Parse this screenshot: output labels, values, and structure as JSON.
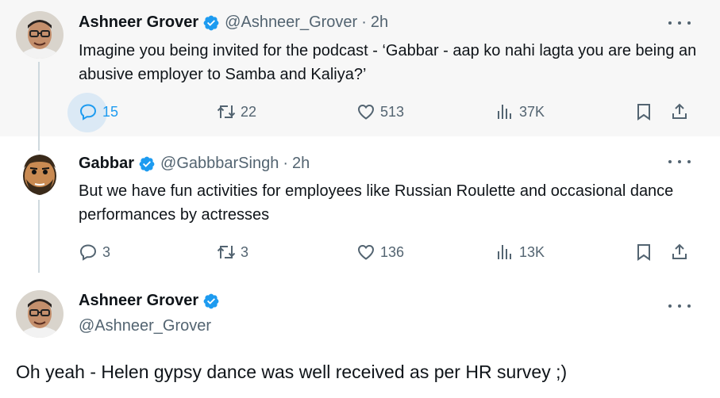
{
  "tweets": [
    {
      "name": "Ashneer Grover",
      "handle": "@Ashneer_Grover",
      "dot": "·",
      "time": "2h",
      "text": "Imagine you being invited for the podcast - ‘Gabbar - aap ko nahi lagta you are being an abusive employer to Samba and Kaliya?’",
      "replies": "15",
      "retweets": "22",
      "likes": "513",
      "views": "37K"
    },
    {
      "name": "Gabbar",
      "handle": "@GabbbarSingh",
      "dot": "·",
      "time": "2h",
      "text": "But we have fun activities for employees like Russian Roulette and occasional dance performances by actresses",
      "replies": "3",
      "retweets": "3",
      "likes": "136",
      "views": "13K"
    }
  ],
  "focus_tweet": {
    "name": "Ashneer Grover",
    "handle": "@Ashneer_Grover",
    "text": "Oh yeah - Helen gypsy dance was well received as per HR survey ;)"
  },
  "colors": {
    "accent": "#1d9bf0",
    "secondary_text": "#536471",
    "hover_bg": "#f7f7f7"
  },
  "icons": [
    "verified-badge-icon",
    "more-icon",
    "reply-icon",
    "retweet-icon",
    "like-icon",
    "views-icon",
    "bookmark-icon",
    "share-icon"
  ]
}
